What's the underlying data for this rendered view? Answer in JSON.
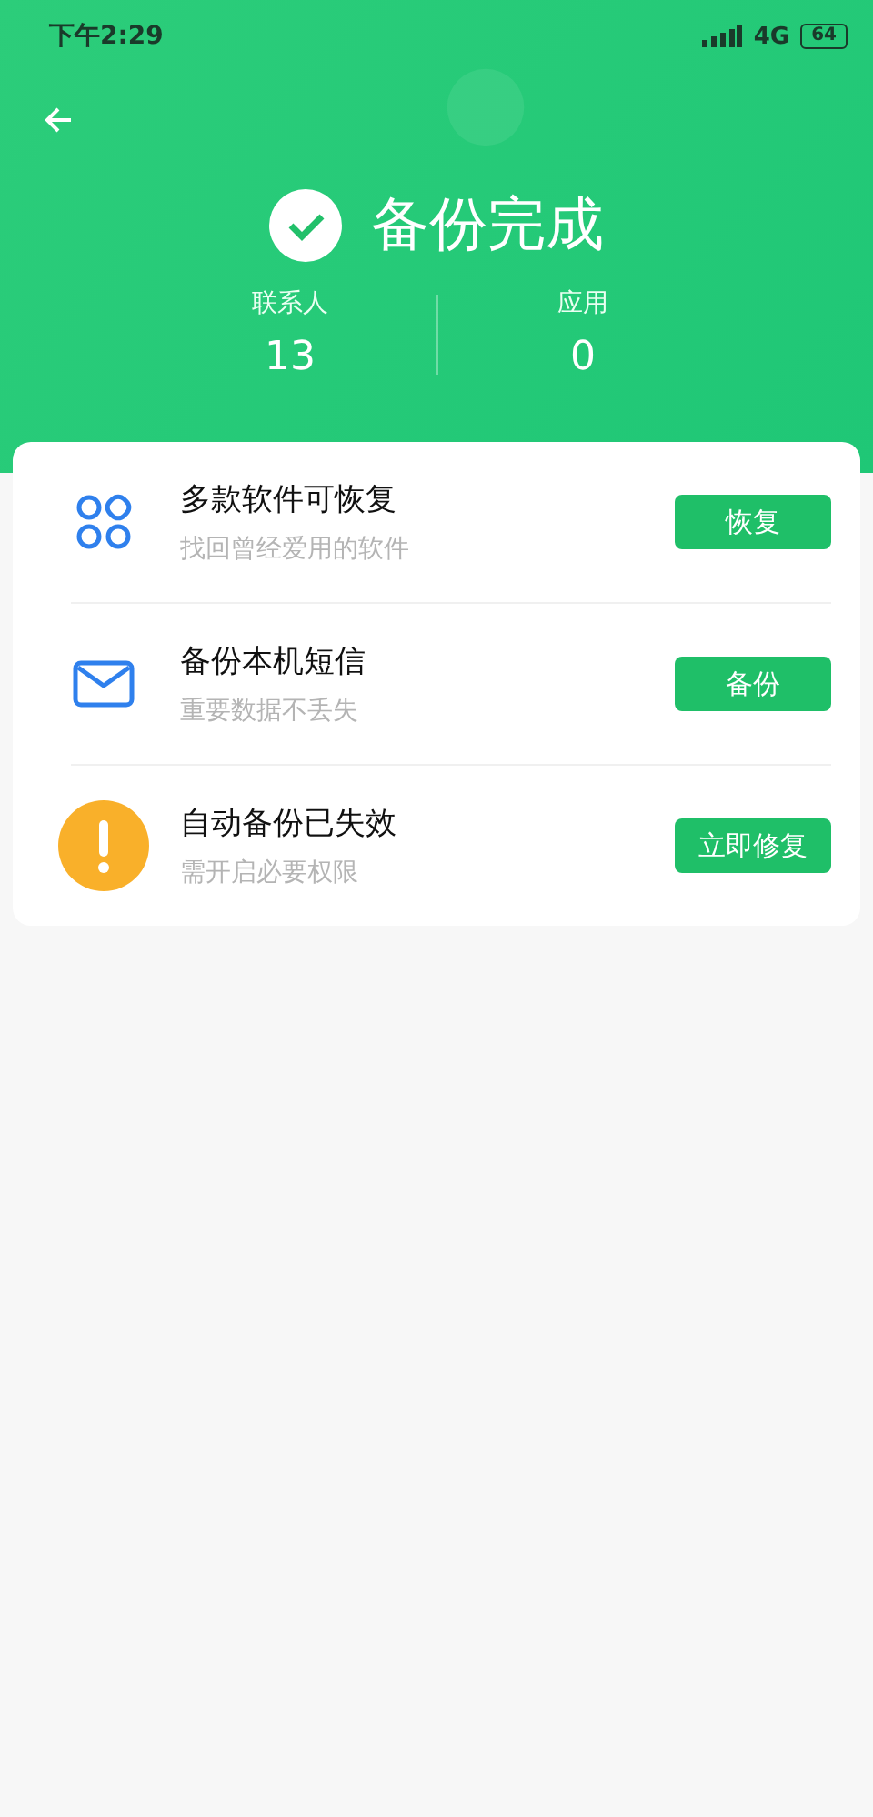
{
  "status_bar": {
    "time": "下午2:29",
    "network": "4G",
    "battery": "64"
  },
  "header": {
    "title": "备份完成",
    "stats": [
      {
        "label": "联系人",
        "value": "13"
      },
      {
        "label": "应用",
        "value": "0"
      }
    ]
  },
  "items": [
    {
      "kind": "apps",
      "title": "多款软件可恢复",
      "subtitle": "找回曾经爱用的软件",
      "button": "恢复"
    },
    {
      "kind": "sms",
      "title": "备份本机短信",
      "subtitle": "重要数据不丢失",
      "button": "备份"
    },
    {
      "kind": "warning",
      "title": "自动备份已失效",
      "subtitle": "需开启必要权限",
      "button": "立即修复"
    }
  ]
}
